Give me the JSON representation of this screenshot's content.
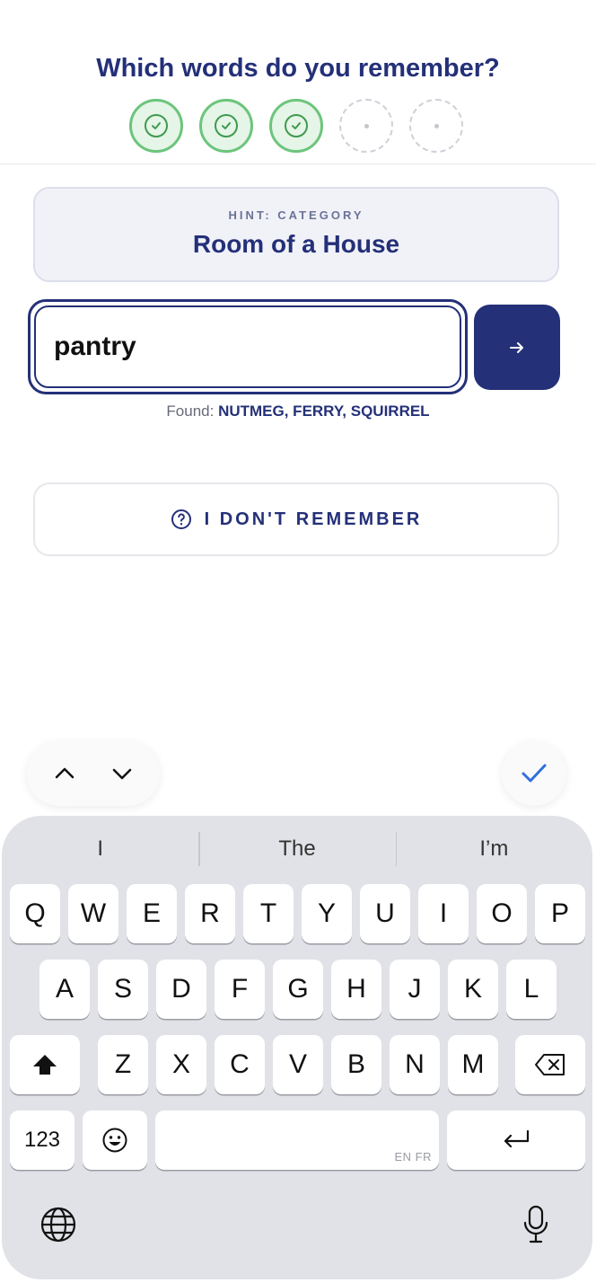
{
  "header": {
    "title": "Which words do you remember?",
    "progress": [
      {
        "state": "found"
      },
      {
        "state": "found"
      },
      {
        "state": "found"
      },
      {
        "state": "empty"
      },
      {
        "state": "empty"
      }
    ]
  },
  "hint": {
    "label": "HINT: CATEGORY",
    "value": "Room of a House"
  },
  "answer": {
    "value": "pantry",
    "submit_icon": "arrow-right-icon"
  },
  "found": {
    "label": "Found:",
    "words": "NUTMEG, FERRY, SQUIRREL"
  },
  "dont_remember": {
    "label": "I DON'T REMEMBER",
    "icon": "question-circle-icon"
  },
  "keyboard_toolbar": {
    "prev_icon": "chevron-up-icon",
    "next_icon": "chevron-down-icon",
    "done_icon": "checkmark-icon",
    "accent": "#2f6fe0"
  },
  "keyboard": {
    "suggestions": [
      "I",
      "The",
      "I’m"
    ],
    "row1": [
      "Q",
      "W",
      "E",
      "R",
      "T",
      "Y",
      "U",
      "I",
      "O",
      "P"
    ],
    "row2": [
      "A",
      "S",
      "D",
      "F",
      "G",
      "H",
      "J",
      "K",
      "L"
    ],
    "row3": [
      "Z",
      "X",
      "C",
      "V",
      "B",
      "N",
      "M"
    ],
    "numbers_label": "123",
    "space_lang": "EN FR",
    "shift_icon": "shift-icon",
    "backspace_icon": "backspace-icon",
    "emoji_icon": "emoji-icon",
    "return_icon": "return-icon",
    "globe_icon": "globe-icon",
    "mic_icon": "microphone-icon"
  },
  "colors": {
    "brand": "#243078",
    "success": "#6cc57c",
    "keyboard_bg": "#e1e2e7"
  }
}
